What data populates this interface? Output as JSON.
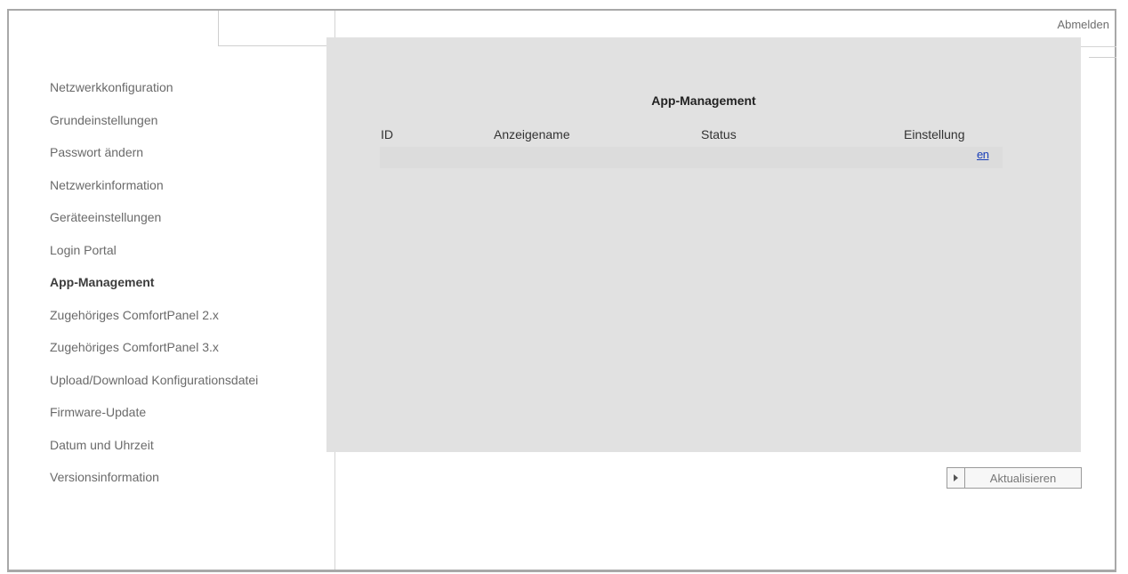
{
  "header": {
    "logout_label": "Abmelden"
  },
  "sidebar": {
    "items": [
      {
        "label": "Netzwerkkonfiguration",
        "active": false
      },
      {
        "label": "Grundeinstellungen",
        "active": false
      },
      {
        "label": "Passwort ändern",
        "active": false
      },
      {
        "label": "Netzwerkinformation",
        "active": false
      },
      {
        "label": "Geräteeinstellungen",
        "active": false
      },
      {
        "label": "Login Portal",
        "active": false
      },
      {
        "label": "App-Management",
        "active": true
      },
      {
        "label": "Zugehöriges ComfortPanel 2.x",
        "active": false
      },
      {
        "label": "Zugehöriges ComfortPanel 3.x",
        "active": false
      },
      {
        "label": "Upload/Download Konfigurationsdatei",
        "active": false
      },
      {
        "label": "Firmware-Update",
        "active": false
      },
      {
        "label": "Datum und Uhrzeit",
        "active": false
      },
      {
        "label": "Versionsinformation",
        "active": false
      }
    ]
  },
  "main": {
    "title": "App-Management",
    "table": {
      "columns": [
        "ID",
        "Anzeigename",
        "Status",
        "Einstellung"
      ],
      "row_partial_link": "en"
    },
    "refresh_label": "Aktualisieren"
  }
}
